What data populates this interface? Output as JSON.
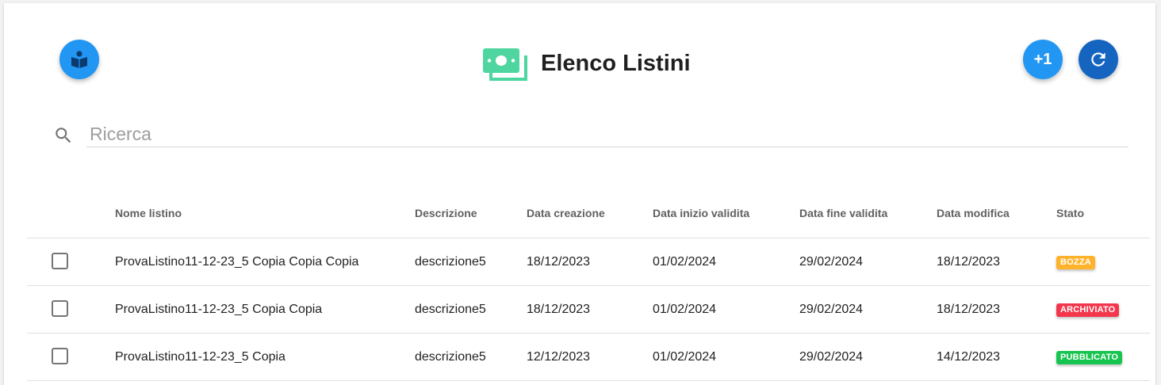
{
  "header": {
    "title": "Elenco Listini",
    "help_icon": "book-reader-icon",
    "title_icon": "money-bills-icon",
    "add_button_label": "+1",
    "refresh_icon": "refresh-icon"
  },
  "search": {
    "placeholder": "Ricerca",
    "value": ""
  },
  "table": {
    "columns": [
      "Nome listino",
      "Descrizione",
      "Data creazione",
      "Data inizio validita",
      "Data fine validita",
      "Data modifica",
      "Stato"
    ],
    "rows": [
      {
        "checked": false,
        "name": "ProvaListino11-12-23_5 Copia Copia Copia",
        "description": "descrizione5",
        "created": "18/12/2023",
        "valid_from": "01/02/2024",
        "valid_to": "29/02/2024",
        "modified": "18/12/2023",
        "status": "BOZZA",
        "status_color": "#ffb22b"
      },
      {
        "checked": false,
        "name": "ProvaListino11-12-23_5 Copia Copia",
        "description": "descrizione5",
        "created": "18/12/2023",
        "valid_from": "01/02/2024",
        "valid_to": "29/02/2024",
        "modified": "18/12/2023",
        "status": "ARCHIVIATO",
        "status_color": "#f4364c"
      },
      {
        "checked": false,
        "name": "ProvaListino11-12-23_5 Copia",
        "description": "descrizione5",
        "created": "12/12/2023",
        "valid_from": "01/02/2024",
        "valid_to": "29/02/2024",
        "modified": "14/12/2023",
        "status": "PUBBLICATO",
        "status_color": "#16c44f"
      }
    ]
  },
  "colors": {
    "primary": "#2196f3",
    "primary_dark": "#1565c0",
    "money_icon": "#4fd6a0"
  }
}
